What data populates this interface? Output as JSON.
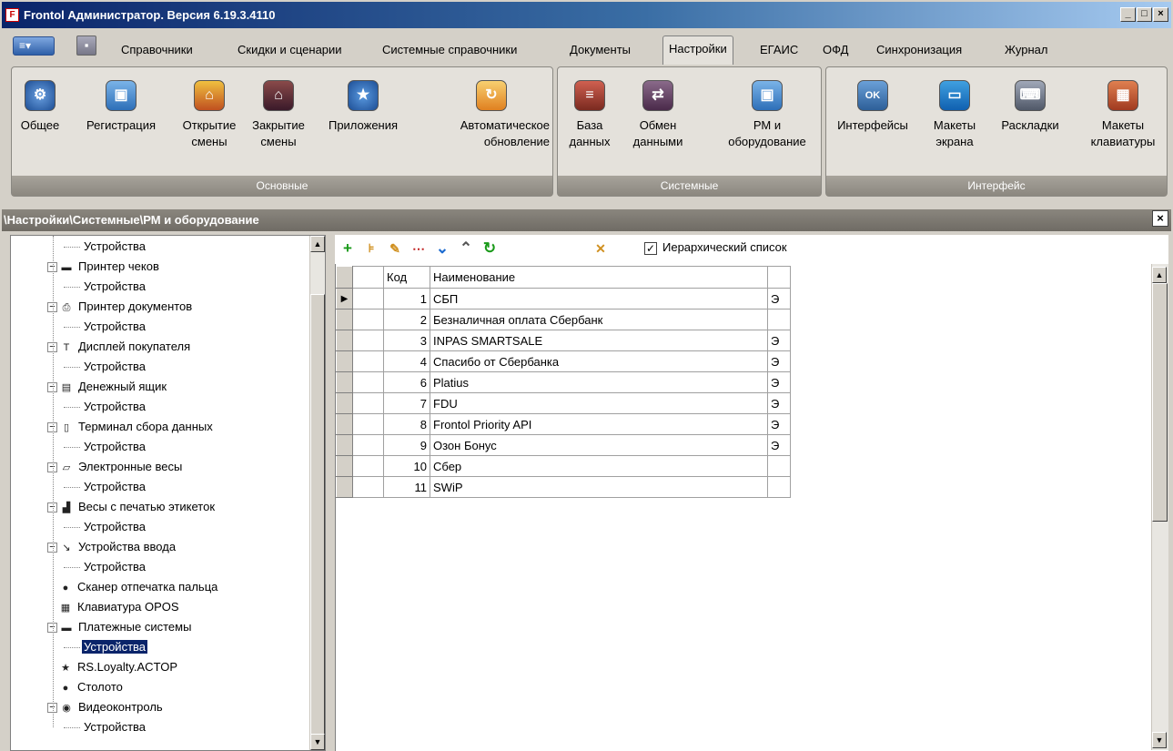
{
  "window": {
    "title": "Frontol Администратор. Версия 6.19.3.4110",
    "min_label": "_",
    "max_label": "□",
    "close_label": "×"
  },
  "menu": {
    "app_button_label": "≡▾",
    "tabs": [
      {
        "label": "Справочники"
      },
      {
        "label": "Скидки и сценарии"
      },
      {
        "label": "Системные справочники"
      },
      {
        "label": "Документы"
      },
      {
        "label": "Настройки",
        "active": true
      },
      {
        "label": "ЕГАИС"
      },
      {
        "label": "ОФД"
      },
      {
        "label": "Синхронизация"
      },
      {
        "label": "Журнал"
      }
    ]
  },
  "ribbon": {
    "groups": [
      {
        "caption": "Основные",
        "buttons": [
          {
            "label": "Общее",
            "icon": "gear-icon"
          },
          {
            "label": "Регистрация",
            "icon": "register-icon"
          },
          {
            "label": "Открытие\nсмены",
            "icon": "shift-open-icon"
          },
          {
            "label": "Закрытие\nсмены",
            "icon": "shift-close-icon"
          },
          {
            "label": "Приложения",
            "icon": "apps-icon"
          },
          {
            "label": "Автоматическое\nобновление",
            "icon": "update-icon"
          }
        ]
      },
      {
        "caption": "Системные",
        "buttons": [
          {
            "label": "База\nданных",
            "icon": "database-icon"
          },
          {
            "label": "Обмен\nданными",
            "icon": "exchange-icon"
          },
          {
            "label": "РМ и\nоборудование",
            "icon": "workstation-icon"
          }
        ]
      },
      {
        "caption": "Интерфейс",
        "buttons": [
          {
            "label": "Интерфейсы",
            "icon": "interface-icon"
          },
          {
            "label": "Макеты\nэкрана",
            "icon": "monitor-icon"
          },
          {
            "label": "Раскладки",
            "icon": "keyboard-icon"
          },
          {
            "label": "Макеты\nклавиатуры",
            "icon": "keypad-icon"
          }
        ]
      }
    ]
  },
  "panel": {
    "path": "\\Настройки\\Системные\\РМ и оборудование",
    "close_label": "×"
  },
  "tree": {
    "nodes": [
      {
        "label": "Устройства",
        "level": 2,
        "icon": ""
      },
      {
        "label": "Принтер чеков",
        "level": 1,
        "icon": "receipt-printer-icon",
        "expandable": true
      },
      {
        "label": "Устройства",
        "level": 2,
        "icon": ""
      },
      {
        "label": "Принтер документов",
        "level": 1,
        "icon": "document-printer-icon",
        "expandable": true
      },
      {
        "label": "Устройства",
        "level": 2,
        "icon": ""
      },
      {
        "label": "Дисплей покупателя",
        "level": 1,
        "icon": "customer-display-icon",
        "expandable": true
      },
      {
        "label": "Устройства",
        "level": 2,
        "icon": ""
      },
      {
        "label": "Денежный ящик",
        "level": 1,
        "icon": "cash-drawer-icon",
        "expandable": true
      },
      {
        "label": "Устройства",
        "level": 2,
        "icon": ""
      },
      {
        "label": "Терминал сбора данных",
        "level": 1,
        "icon": "data-terminal-icon",
        "expandable": true
      },
      {
        "label": "Устройства",
        "level": 2,
        "icon": ""
      },
      {
        "label": "Электронные весы",
        "level": 1,
        "icon": "scales-icon",
        "expandable": true
      },
      {
        "label": "Устройства",
        "level": 2,
        "icon": ""
      },
      {
        "label": "Весы с печатью этикеток",
        "level": 1,
        "icon": "label-scales-icon",
        "expandable": true
      },
      {
        "label": "Устройства",
        "level": 2,
        "icon": ""
      },
      {
        "label": "Устройства ввода",
        "level": 1,
        "icon": "input-device-icon",
        "expandable": true
      },
      {
        "label": "Устройства",
        "level": 2,
        "icon": ""
      },
      {
        "label": "Сканер отпечатка пальца",
        "level": 1,
        "icon": "fingerprint-icon"
      },
      {
        "label": "Клавиатура OPOS",
        "level": 1,
        "icon": "opos-keyboard-icon"
      },
      {
        "label": "Платежные системы",
        "level": 1,
        "icon": "payment-systems-icon",
        "expandable": true
      },
      {
        "label": "Устройства",
        "level": 2,
        "icon": "",
        "selected": true
      },
      {
        "label": "RS.Loyalty.ACTOP",
        "level": 1,
        "icon": "loyalty-icon"
      },
      {
        "label": "Столото",
        "level": 1,
        "icon": "stoloto-icon"
      },
      {
        "label": "Видеоконтроль",
        "level": 1,
        "icon": "video-icon",
        "expandable": true
      },
      {
        "label": "Устройства",
        "level": 2,
        "icon": ""
      }
    ]
  },
  "toolbar": {
    "checkbox_label": "Иерархический список",
    "checkbox_checked": true,
    "checkbox_mark": "✓"
  },
  "grid": {
    "columns": [
      "Код",
      "Наименование",
      ""
    ],
    "rows": [
      {
        "code": "1",
        "name": "СБП",
        "extra": "Э",
        "current": true
      },
      {
        "code": "2",
        "name": "Безналичная оплата Сбербанк",
        "extra": ""
      },
      {
        "code": "3",
        "name": "INPAS SMARTSALE",
        "extra": "Э"
      },
      {
        "code": "4",
        "name": "Спасибо от Сбербанка",
        "extra": "Э"
      },
      {
        "code": "6",
        "name": "Platius",
        "extra": "Э"
      },
      {
        "code": "7",
        "name": "FDU",
        "extra": "Э"
      },
      {
        "code": "8",
        "name": "Frontol Priority API",
        "extra": "Э"
      },
      {
        "code": "9",
        "name": "Озон Бонус",
        "extra": "Э"
      },
      {
        "code": "10",
        "name": "Сбер",
        "extra": ""
      },
      {
        "code": "11",
        "name": "SWiP",
        "extra": ""
      }
    ]
  }
}
